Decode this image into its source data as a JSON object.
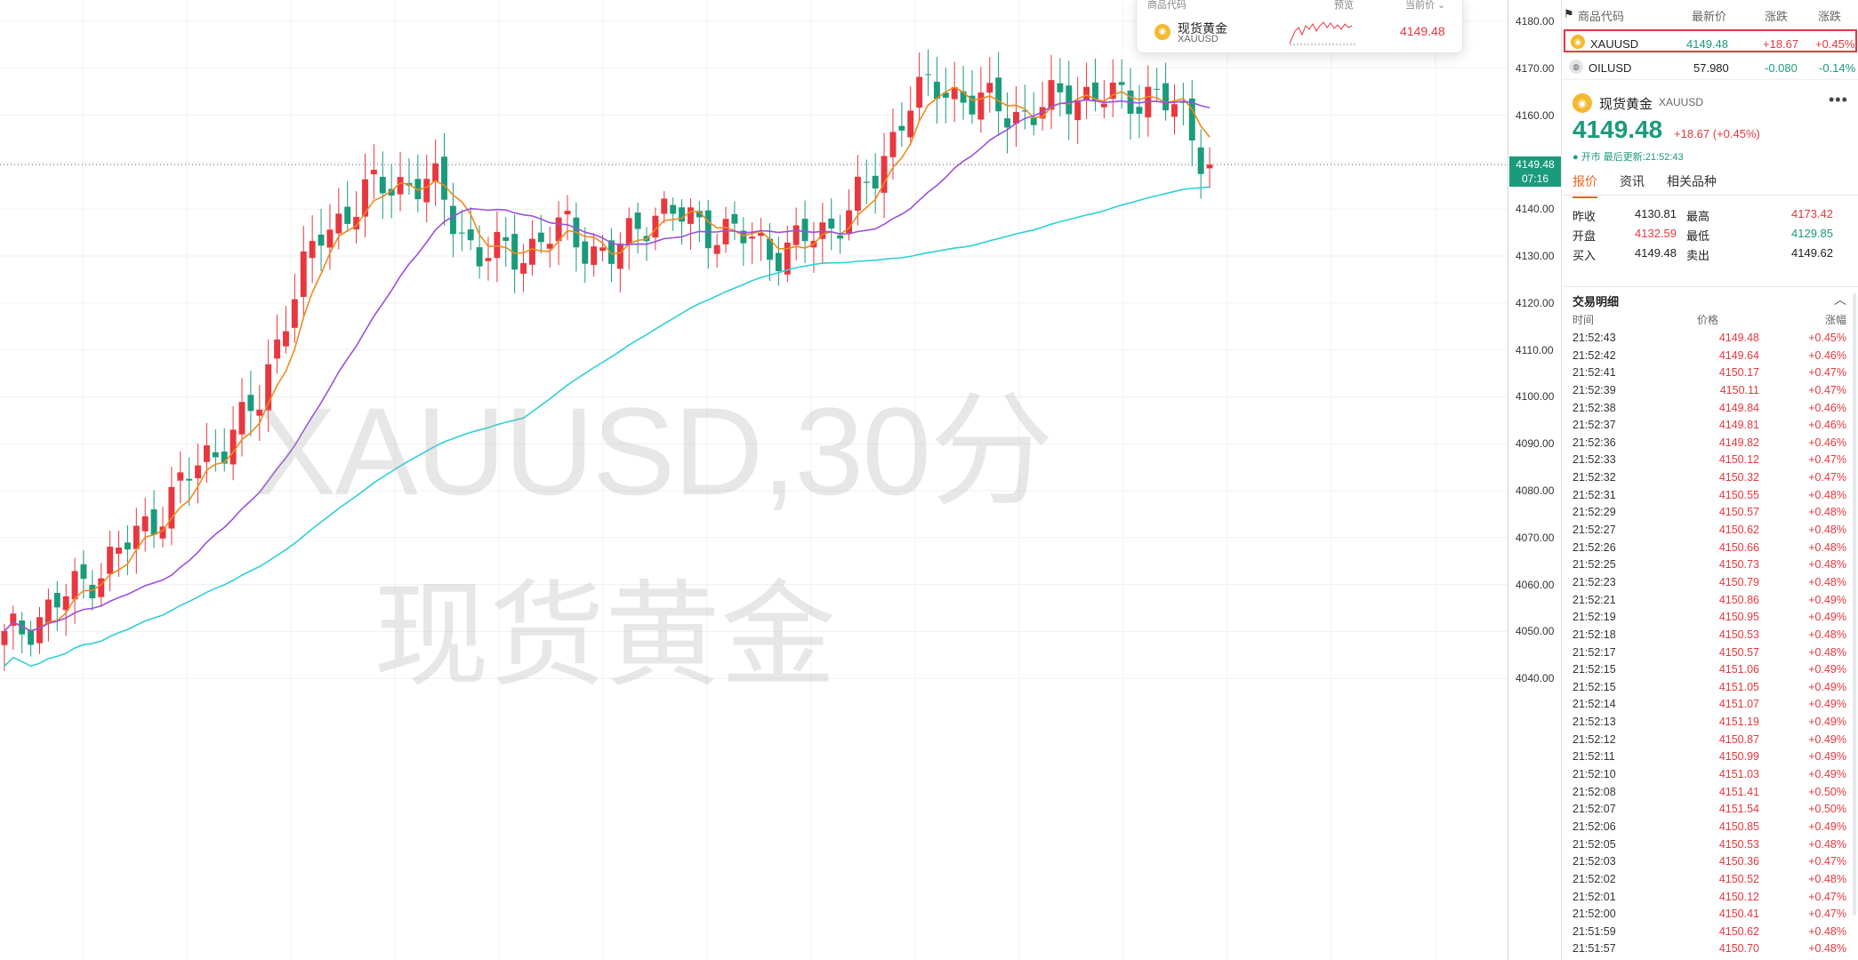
{
  "watermark": {
    "line1": "XAUUSD,30分",
    "line2": "现货黄金"
  },
  "axis": {
    "ticks": [
      "4180.00",
      "4170.00",
      "4160.00",
      "4150.00",
      "4140.00",
      "4130.00",
      "4120.00",
      "4110.00",
      "4100.00",
      "4090.00",
      "4080.00",
      "4070.00",
      "4060.00",
      "4050.00",
      "4040.00"
    ],
    "current_price": "4149.48",
    "countdown": "07:16"
  },
  "popup": {
    "col1": "商品代码",
    "col2": "预览",
    "col3": "当前价 ⌄",
    "name": "现货黄金",
    "code": "XAUUSD",
    "price": "4149.48"
  },
  "watchlist": {
    "headers": {
      "code": "商品代码",
      "last": "最新价",
      "change": "涨跌",
      "pct": "涨跌"
    },
    "rows": [
      {
        "icon": "gold-coin-icon",
        "code": "XAUUSD",
        "last": "4149.48",
        "change": "+18.67",
        "pct": "+0.45%"
      },
      {
        "icon": "oil-icon",
        "code": "OILUSD",
        "last": "57.980",
        "change": "-0.080",
        "pct": "-0.14%"
      }
    ]
  },
  "info": {
    "name": "现货黄金",
    "code": "XAUUSD",
    "more": "•••",
    "price": "4149.48",
    "change": "+18.67 (+0.45%)",
    "status": "● 开市 最后更新:21:52:43"
  },
  "tabs": [
    "报价",
    "资讯",
    "相关品种"
  ],
  "quote": {
    "rows": [
      {
        "l1": "昨收",
        "v1": "4130.81",
        "l2": "最高",
        "v2": "4173.42",
        "c1": "",
        "c2": "red"
      },
      {
        "l1": "开盘",
        "v1": "4132.59",
        "l2": "最低",
        "v2": "4129.85",
        "c1": "red",
        "c2": "green"
      },
      {
        "l1": "买入",
        "v1": "4149.48",
        "l2": "卖出",
        "v2": "4149.62",
        "c1": "",
        "c2": ""
      }
    ]
  },
  "trades": {
    "title": "交易明细",
    "headers": {
      "time": "时间",
      "price": "价格",
      "pct": "涨幅"
    },
    "rows": [
      [
        "21:52:43",
        "4149.48",
        "+0.45%"
      ],
      [
        "21:52:42",
        "4149.64",
        "+0.46%"
      ],
      [
        "21:52:41",
        "4150.17",
        "+0.47%"
      ],
      [
        "21:52:39",
        "4150.11",
        "+0.47%"
      ],
      [
        "21:52:38",
        "4149.84",
        "+0.46%"
      ],
      [
        "21:52:37",
        "4149.81",
        "+0.46%"
      ],
      [
        "21:52:36",
        "4149.82",
        "+0.46%"
      ],
      [
        "21:52:33",
        "4150.12",
        "+0.47%"
      ],
      [
        "21:52:32",
        "4150.32",
        "+0.47%"
      ],
      [
        "21:52:31",
        "4150.55",
        "+0.48%"
      ],
      [
        "21:52:29",
        "4150.57",
        "+0.48%"
      ],
      [
        "21:52:27",
        "4150.62",
        "+0.48%"
      ],
      [
        "21:52:26",
        "4150.66",
        "+0.48%"
      ],
      [
        "21:52:25",
        "4150.73",
        "+0.48%"
      ],
      [
        "21:52:23",
        "4150.79",
        "+0.48%"
      ],
      [
        "21:52:21",
        "4150.86",
        "+0.49%"
      ],
      [
        "21:52:19",
        "4150.95",
        "+0.49%"
      ],
      [
        "21:52:18",
        "4150.53",
        "+0.48%"
      ],
      [
        "21:52:17",
        "4150.57",
        "+0.48%"
      ],
      [
        "21:52:15",
        "4151.06",
        "+0.49%"
      ],
      [
        "21:52:15",
        "4151.05",
        "+0.49%"
      ],
      [
        "21:52:14",
        "4151.07",
        "+0.49%"
      ],
      [
        "21:52:13",
        "4151.19",
        "+0.49%"
      ],
      [
        "21:52:12",
        "4150.87",
        "+0.49%"
      ],
      [
        "21:52:11",
        "4150.99",
        "+0.49%"
      ],
      [
        "21:52:10",
        "4151.03",
        "+0.49%"
      ],
      [
        "21:52:08",
        "4151.41",
        "+0.50%"
      ],
      [
        "21:52:07",
        "4151.54",
        "+0.50%"
      ],
      [
        "21:52:06",
        "4150.85",
        "+0.49%"
      ],
      [
        "21:52:05",
        "4150.53",
        "+0.48%"
      ],
      [
        "21:52:03",
        "4150.36",
        "+0.47%"
      ],
      [
        "21:52:02",
        "4150.52",
        "+0.48%"
      ],
      [
        "21:52:01",
        "4150.12",
        "+0.47%"
      ],
      [
        "21:52:00",
        "4150.41",
        "+0.47%"
      ],
      [
        "21:51:59",
        "4150.62",
        "+0.48%"
      ],
      [
        "21:51:57",
        "4150.70",
        "+0.48%"
      ]
    ]
  },
  "colors": {
    "up": "#e8373e",
    "down": "#1a9b7c",
    "ma_fast": "#ee8a1d",
    "ma_mid": "#9b4fe0",
    "ma_slow": "#2fcfd6"
  }
}
